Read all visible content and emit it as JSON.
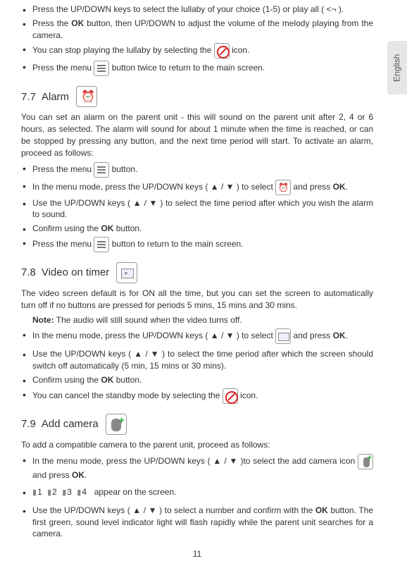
{
  "sideTab": "English",
  "topList": {
    "items": [
      "Press the UP/DOWN keys to select the lullaby of your choice (1-5) or play all ( <¬ ).",
      "Press the OK button, then UP/DOWN to adjust the volume of the melody playing from the camera.",
      "You can stop playing the lullaby by selecting the",
      "Press the menu",
      "button twice to return to the main screen.",
      "icon."
    ]
  },
  "s77": {
    "num": "7.7",
    "title": "Alarm",
    "intro": "You can set an alarm on the parent unit - this will sound on the parent unit after 2, 4 or 6 hours, as selected. The alarm will sound for about 1 minute when the time is reached, or can be stopped by pressing any button, and the next time period will start. To activate an alarm, proceed as follows:",
    "li1a": "Press the menu",
    "li1b": "button.",
    "li2a": "In the menu mode, press the UP/DOWN keys ( ▲ / ▼ ) to select",
    "li2b": "and press OK.",
    "li3": "Use the UP/DOWN keys ( ▲ / ▼ ) to select the time period after which you wish the alarm to sound.",
    "li4": "Confirm using the OK button.",
    "li5a": "Press the menu",
    "li5b": "button to return to the main screen."
  },
  "s78": {
    "num": "7.8",
    "title": "Video on timer",
    "intro": "The video screen default is for ON all the time, but you can set the screen to automatically turn off if no buttons are pressed for periods 5 mins, 15 mins and 30 mins.",
    "note": "Note: The audio will still sound when the video turns off.",
    "li1a": "In the menu mode, press the UP/DOWN keys ( ▲ / ▼ ) to select",
    "li1b": "and press OK.",
    "li2": "Use the UP/DOWN keys ( ▲ / ▼ ) to select the time period after which the screen should switch off automatically (5 min, 15 mins or 30 mins).",
    "li3": "Confirm using the OK button.",
    "li4a": "You can cancel the standby mode by selecting the",
    "li4b": "icon."
  },
  "s79": {
    "num": "7.9",
    "title": "Add camera",
    "intro": "To add a compatible camera to the parent unit, proceed as follows:",
    "li1a": "In the menu mode, press the UP/DOWN keys ( ▲ / ▼ )to select the add camera icon",
    "li1b": "and press OK.",
    "li2nums": [
      "1",
      "2",
      "3",
      "4"
    ],
    "li2b": "appear on the screen.",
    "li3": "Use the UP/DOWN keys ( ▲ / ▼ ) to select a number and confirm with the OK button. The first green, sound level indicator light will flash rapidly while the parent unit searches for a camera."
  },
  "pageNum": "11"
}
